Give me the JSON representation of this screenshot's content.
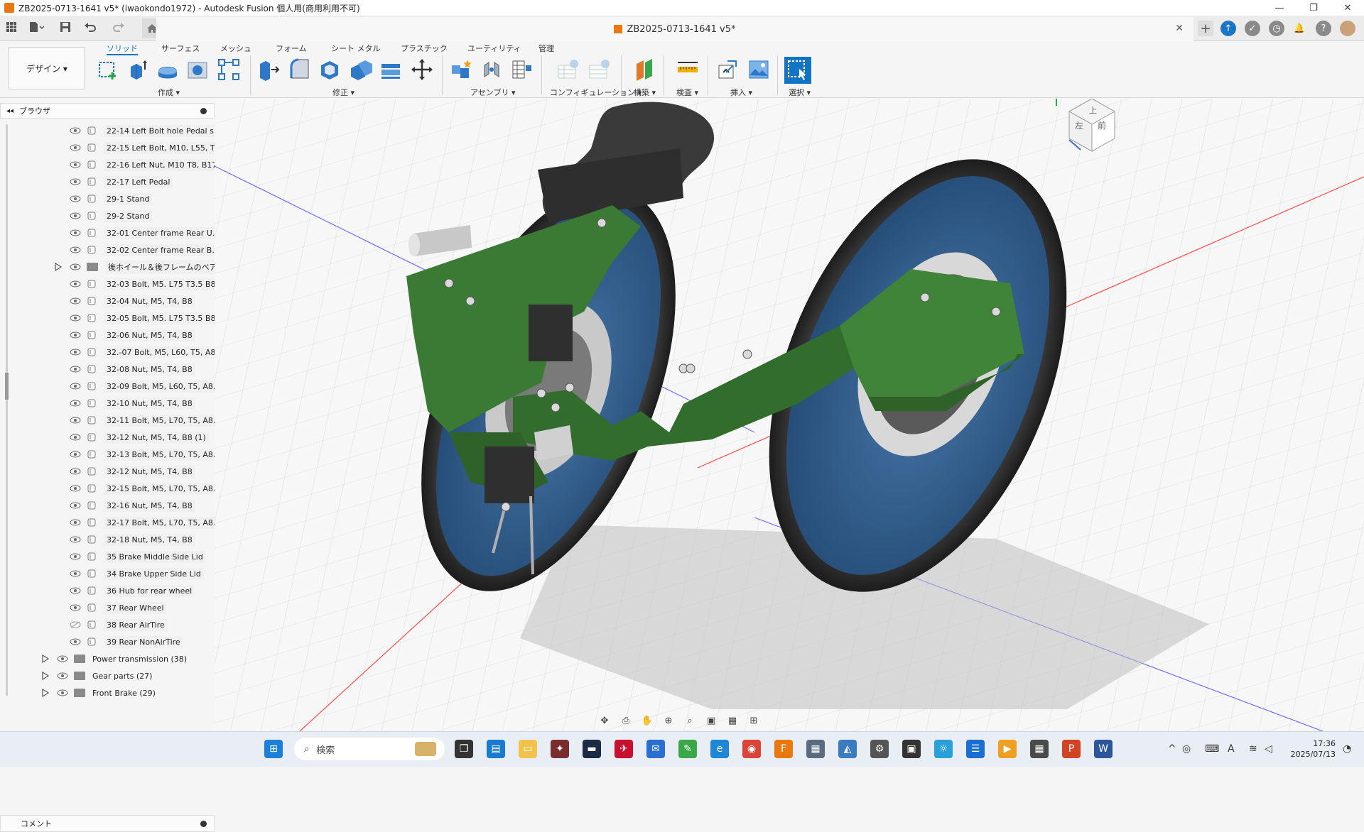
{
  "window": {
    "title": "ZB2025-0713-1641 v5* (iwaokondo1972) - Autodesk Fusion 個人用(商用利用不可)",
    "controls": {
      "minimize": "—",
      "restore": "❐",
      "close": "✕"
    }
  },
  "doc_tab": {
    "title": "ZB2025-0713-1641 v5*",
    "close": "✕"
  },
  "workspace": {
    "label": "デザイン ▾"
  },
  "toolbar_tabs": [
    "ソリッド",
    "サーフェス",
    "メッシュ",
    "フォーム",
    "シート メタル",
    "プラスチック",
    "ユーティリティ",
    "管理"
  ],
  "active_tab": "ソリッド",
  "groups": {
    "create": "作成 ▾",
    "modify": "修正 ▾",
    "assemble": "アセンブリ ▾",
    "configure": "コンフィギュレーション ▾",
    "construct": "構築 ▾",
    "inspect": "検査 ▾",
    "insert": "挿入 ▾",
    "select": "選択 ▾"
  },
  "browser": {
    "title": "ブラウザ",
    "items": [
      {
        "label": "22-14 Left Bolt hole Pedal s...",
        "type": "component",
        "hidden": false
      },
      {
        "label": "22-15 Left Bolt, M10, L55, T...",
        "type": "component",
        "hidden": false
      },
      {
        "label": "22-16 Left Nut, M10 T8, B17",
        "type": "component",
        "hidden": false
      },
      {
        "label": "22-17 Left Pedal",
        "type": "component",
        "hidden": false
      },
      {
        "label": "29-1 Stand",
        "type": "component",
        "hidden": false
      },
      {
        "label": "29-2 Stand",
        "type": "component",
        "hidden": false
      },
      {
        "label": "32-01 Center frame Rear U...",
        "type": "component",
        "hidden": false
      },
      {
        "label": "32-02 Center frame Rear B...",
        "type": "component",
        "hidden": false
      },
      {
        "label": "後ホイール＆後フレームのベアリ...",
        "type": "folder",
        "hidden": false
      },
      {
        "label": "32-03 Bolt, M5. L75 T3.5 B8",
        "type": "component",
        "hidden": false
      },
      {
        "label": "32-04 Nut, M5, T4, B8",
        "type": "component",
        "hidden": false
      },
      {
        "label": "32-05 Bolt, M5. L75 T3.5 B8",
        "type": "component",
        "hidden": false
      },
      {
        "label": "32-06 Nut, M5, T4, B8",
        "type": "component",
        "hidden": false
      },
      {
        "label": "32.-07 Bolt, M5, L60, T5, A8...",
        "type": "component",
        "hidden": false
      },
      {
        "label": "32-08 Nut, M5, T4, B8",
        "type": "component",
        "hidden": false
      },
      {
        "label": "32-09 Bolt, M5, L60, T5, A8...",
        "type": "component",
        "hidden": false
      },
      {
        "label": "32-10 Nut, M5, T4, B8",
        "type": "component",
        "hidden": false
      },
      {
        "label": "32-11 Bolt, M5, L70, T5, A8...",
        "type": "component",
        "hidden": false
      },
      {
        "label": "32-12 Nut, M5, T4, B8 (1)",
        "type": "component",
        "hidden": false
      },
      {
        "label": "32-13 Bolt, M5, L70, T5, A8...",
        "type": "component",
        "hidden": false
      },
      {
        "label": "32-12 Nut, M5, T4, B8",
        "type": "component",
        "hidden": false
      },
      {
        "label": "32-15 Bolt, M5, L70, T5, A8...",
        "type": "component",
        "hidden": false
      },
      {
        "label": "32-16 Nut, M5, T4, B8",
        "type": "component",
        "hidden": false
      },
      {
        "label": "32-17 Bolt, M5, L70, T5, A8...",
        "type": "component",
        "hidden": false
      },
      {
        "label": "32-18 Nut, M5, T4, B8",
        "type": "component",
        "hidden": false
      },
      {
        "label": "35 Brake Middle Side Lid",
        "type": "component",
        "hidden": false
      },
      {
        "label": "34 Brake Upper Side Lid",
        "type": "component",
        "hidden": false
      },
      {
        "label": "36 Hub for rear wheel",
        "type": "component",
        "hidden": false
      },
      {
        "label": "37 Rear Wheel",
        "type": "component",
        "hidden": false
      },
      {
        "label": "38 Rear AirTire",
        "type": "component",
        "hidden": true
      },
      {
        "label": "39 Rear NonAirTire",
        "type": "component",
        "hidden": false
      }
    ],
    "folders": [
      {
        "label": "Power transmission (38)"
      },
      {
        "label": "Gear parts (27)"
      },
      {
        "label": "Front Brake (29)"
      }
    ]
  },
  "comments": {
    "title": "コメント"
  },
  "viewcube": {
    "top": "上",
    "left": "左",
    "front": "前"
  },
  "taskbar": {
    "search_placeholder": "検索",
    "time": "17:36",
    "date": "2025/07/13"
  },
  "colors": {
    "accent": "#1474c4",
    "fusion_orange": "#e8780f",
    "frame_green": "#3a7a34",
    "wheel_blue": "#2f5e8e",
    "tire_dark": "#3a3a3a"
  }
}
